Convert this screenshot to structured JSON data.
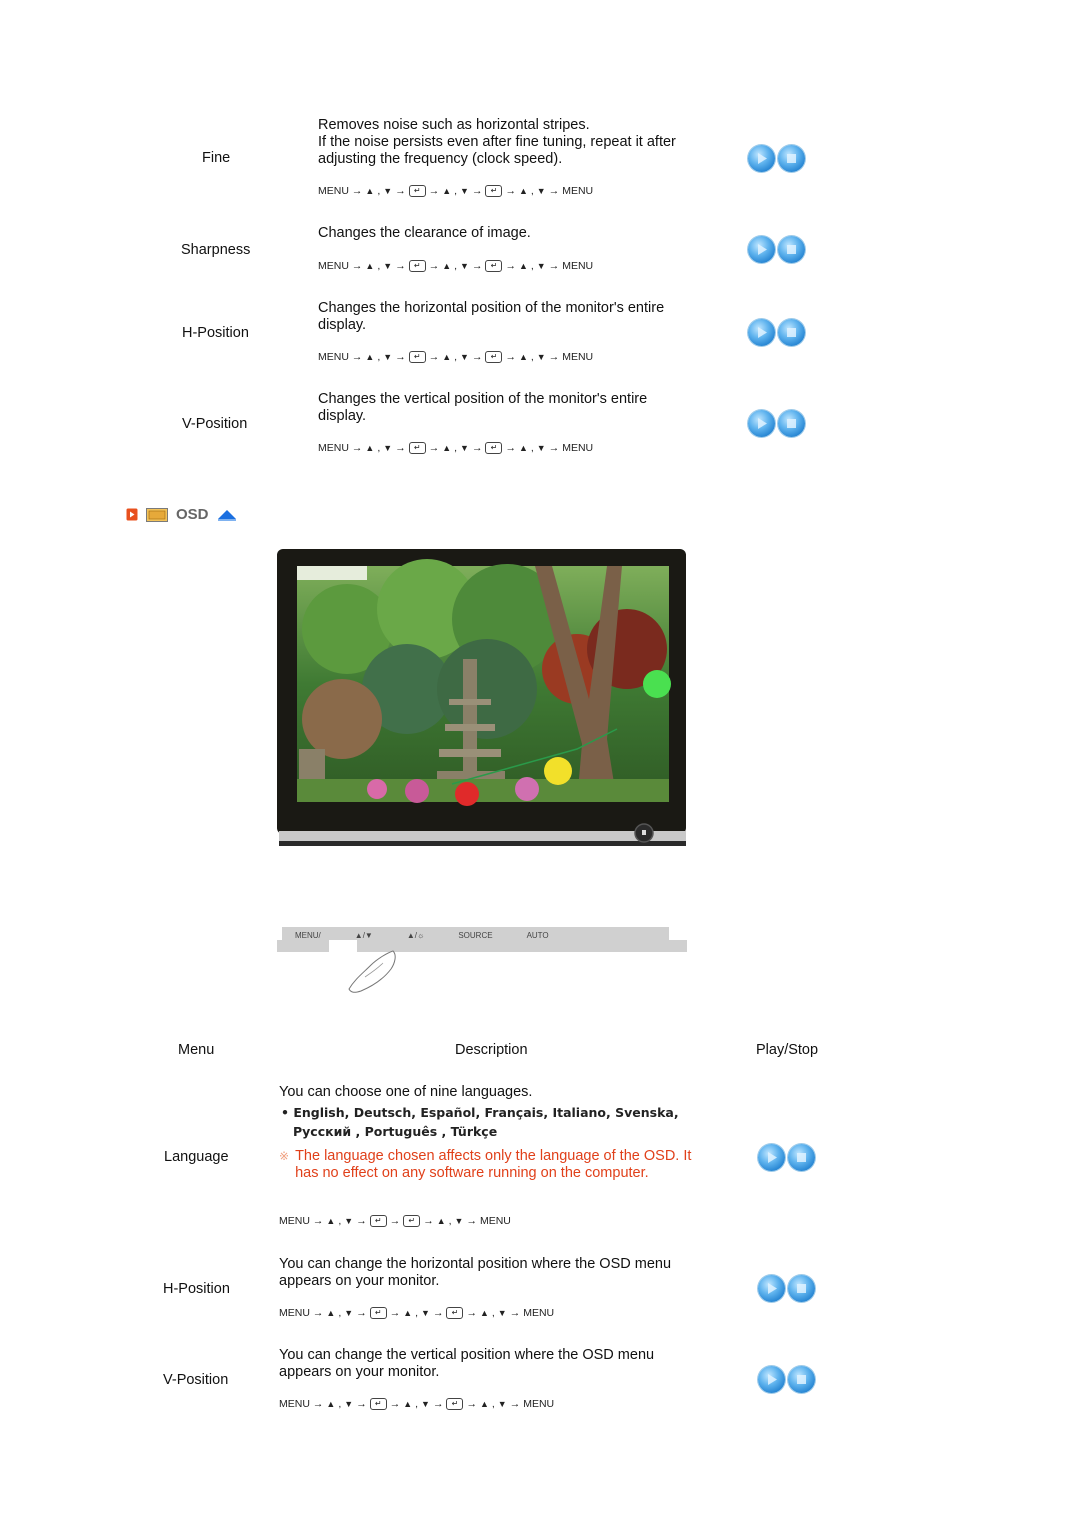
{
  "picture_rows": [
    {
      "label": "Fine",
      "description_lines": [
        "Removes noise such as horizontal stripes.",
        "If the noise persists even after fine tuning, repeat it after",
        "adjusting the frequency (clock speed)."
      ],
      "sequence": [
        "MENU",
        "→",
        "▲",
        ",",
        "▼",
        "→",
        "↵",
        "→",
        "▲",
        ",",
        "▼",
        "→",
        "↵",
        "→",
        "▲",
        ",",
        "▼",
        "→",
        "MENU"
      ]
    },
    {
      "label": "Sharpness",
      "description_lines": [
        "Changes the clearance of image."
      ],
      "sequence": [
        "MENU",
        "→",
        "▲",
        ",",
        "▼",
        "→",
        "↵",
        "→",
        "▲",
        ",",
        "▼",
        "→",
        "↵",
        "→",
        "▲",
        ",",
        "▼",
        "→",
        "MENU"
      ]
    },
    {
      "label": "H-Position",
      "description_lines": [
        "Changes the horizontal position of the monitor's entire",
        "display."
      ],
      "sequence": [
        "MENU",
        "→",
        "▲",
        ",",
        "▼",
        "→",
        "↵",
        "→",
        "▲",
        ",",
        "▼",
        "→",
        "↵",
        "→",
        "▲",
        ",",
        "▼",
        "→",
        "MENU"
      ]
    },
    {
      "label": "V-Position",
      "description_lines": [
        "Changes the vertical position of the monitor's entire",
        "display."
      ],
      "sequence": [
        "MENU",
        "→",
        "▲",
        ",",
        "▼",
        "→",
        "↵",
        "→",
        "▲",
        ",",
        "▼",
        "→",
        "↵",
        "→",
        "▲",
        ",",
        "▼",
        "→",
        "MENU"
      ]
    }
  ],
  "osd_section": {
    "title": "OSD",
    "icons": [
      "play-bullet-icon",
      "osd-category-icon",
      "back-to-top-icon"
    ],
    "monitor_image_alt": "Monitor displaying a garden with pagodas, trees and lanterns",
    "control_strip_labels": [
      "MENU/",
      "▲/▼",
      "▲/☼",
      "SOURCE",
      "AUTO"
    ]
  },
  "table_header": {
    "menu": "Menu",
    "description": "Description",
    "play_stop": "Play/Stop"
  },
  "osd_rows": [
    {
      "label": "Language",
      "description_lines": [
        "You can choose one of nine languages."
      ],
      "languages_line1": "• English, Deutsch, Español, Français,  Italiano, Svenska,",
      "languages_line2": "Русский , Português , Türkçe",
      "note_mark": "※",
      "note_lines": [
        "The language chosen affects only the language of the OSD. It",
        "has no effect on any software running on the computer."
      ],
      "sequence": [
        "MENU",
        "→",
        "▲",
        ",",
        "▼",
        "→",
        "↵",
        "→",
        "↵",
        "→",
        "▲",
        ",",
        "▼",
        "→",
        "MENU"
      ]
    },
    {
      "label": "H-Position",
      "description_lines": [
        "You can change the horizontal position where the OSD menu",
        "appears on your monitor."
      ],
      "sequence": [
        "MENU",
        "→",
        "▲",
        ",",
        "▼",
        "→",
        "↵",
        "→",
        "▲",
        ",",
        "▼",
        "→",
        "↵",
        "→",
        "▲",
        ",",
        "▼",
        "→",
        "MENU"
      ]
    },
    {
      "label": "V-Position",
      "description_lines": [
        "You can change the vertical position where the OSD menu",
        "appears on your monitor."
      ],
      "sequence": [
        "MENU",
        "→",
        "▲",
        ",",
        "▼",
        "→",
        "↵",
        "→",
        "▲",
        ",",
        "▼",
        "→",
        "↵",
        "→",
        "▲",
        ",",
        "▼",
        "→",
        "MENU"
      ]
    }
  ],
  "colors": {
    "note": "#e0401a",
    "button_blue": "#1f7fcf",
    "osd_title": "#666666",
    "up_arrow": "#1a6fe0",
    "bullet_orange": "#e8501e"
  }
}
